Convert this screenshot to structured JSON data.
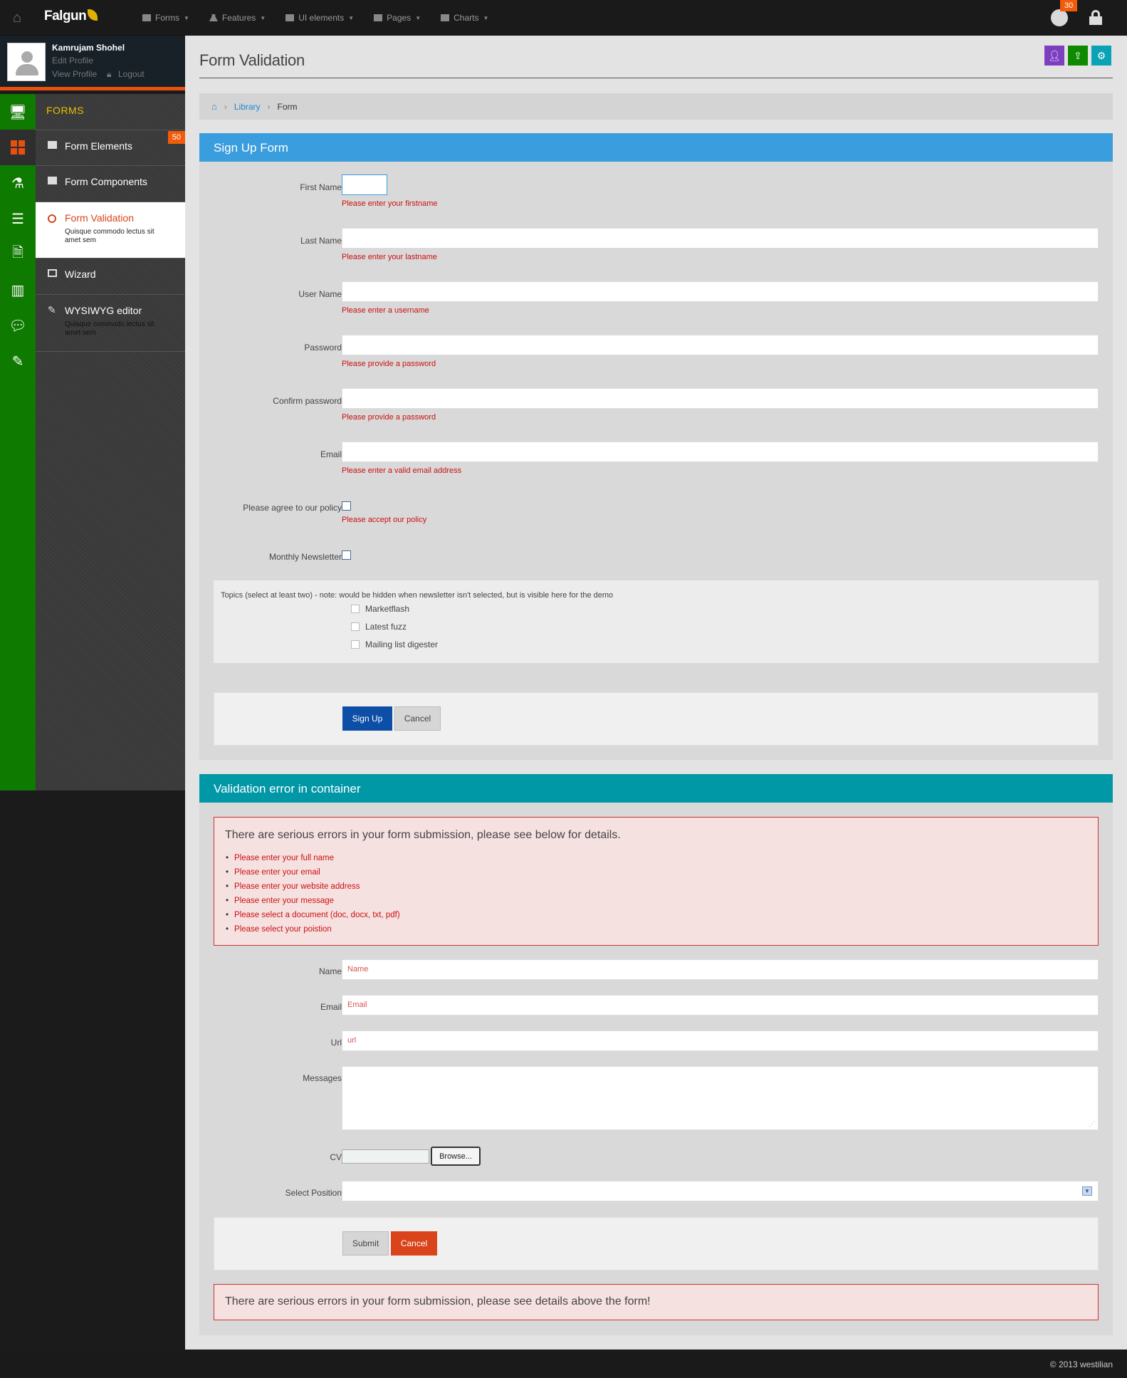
{
  "topbar": {
    "brand": "Falgun",
    "nav": [
      "Forms",
      "Features",
      "UI elements",
      "Pages",
      "Charts"
    ],
    "notif_count": "30"
  },
  "profile": {
    "name": "Kamrujam Shohel",
    "edit": "Edit Profile",
    "view": "View Profile",
    "logout": "Logout"
  },
  "sidebar": {
    "section": "FORMS",
    "count": "50",
    "items": [
      {
        "label": "Form Elements"
      },
      {
        "label": "Form Components"
      },
      {
        "label": "Form Validation",
        "desc": "Quisque commodo lectus sit amet sem"
      },
      {
        "label": "Wizard"
      },
      {
        "label": "WYSIWYG editor",
        "desc": "Quisque commodo lectus sit amet sem"
      }
    ]
  },
  "page": {
    "title": "Form Validation",
    "breadcrumb": [
      "Library",
      "Form"
    ]
  },
  "signup": {
    "title": "Sign Up Form",
    "fields": [
      {
        "label": "First Name",
        "error": "Please enter your firstname"
      },
      {
        "label": "Last Name",
        "error": "Please enter your lastname"
      },
      {
        "label": "User Name",
        "error": "Please enter a username"
      },
      {
        "label": "Password",
        "error": "Please provide a password"
      },
      {
        "label": "Confirm password",
        "error": "Please provide a password"
      },
      {
        "label": "Email",
        "error": "Please enter a valid email address"
      }
    ],
    "policy_label": "Please agree to our policy",
    "policy_error": "Please accept our policy",
    "newsletter_label": "Monthly Newsletter",
    "topics_note": "Topics (select at least two) - note: would be hidden when newsletter isn't selected, but is visible here for the demo",
    "topics": [
      "Marketflash",
      "Latest fuzz",
      "Mailing list digester"
    ],
    "submit": "Sign Up",
    "cancel": "Cancel"
  },
  "container": {
    "title": "Validation error in container",
    "error_heading": "There are serious errors in your form submission, please see below for details.",
    "errors": [
      "Please enter your full name",
      "Please enter your email",
      "Please enter your website address",
      "Please enter your message",
      "Please select a document (doc, docx, txt, pdf)",
      "Please select your poistion"
    ],
    "name_label": "Name",
    "name_ph": "Name",
    "email_label": "Email",
    "email_ph": "Email",
    "url_label": "Url",
    "url_ph": "url",
    "messages_label": "Messages",
    "cv_label": "CV",
    "browse": "Browse...",
    "position_label": "Select Position",
    "submit": "Submit",
    "cancel": "Cancel",
    "bottom_error": "There are serious errors in your form submission, please see details above the form!"
  },
  "footer": {
    "copyright": "© 2013 westilian"
  },
  "colors": {
    "accent": "#3a9ddd",
    "teal": "#0097a7",
    "green": "#0e7a00",
    "orange": "#f35b0a",
    "error": "#cc1010"
  }
}
